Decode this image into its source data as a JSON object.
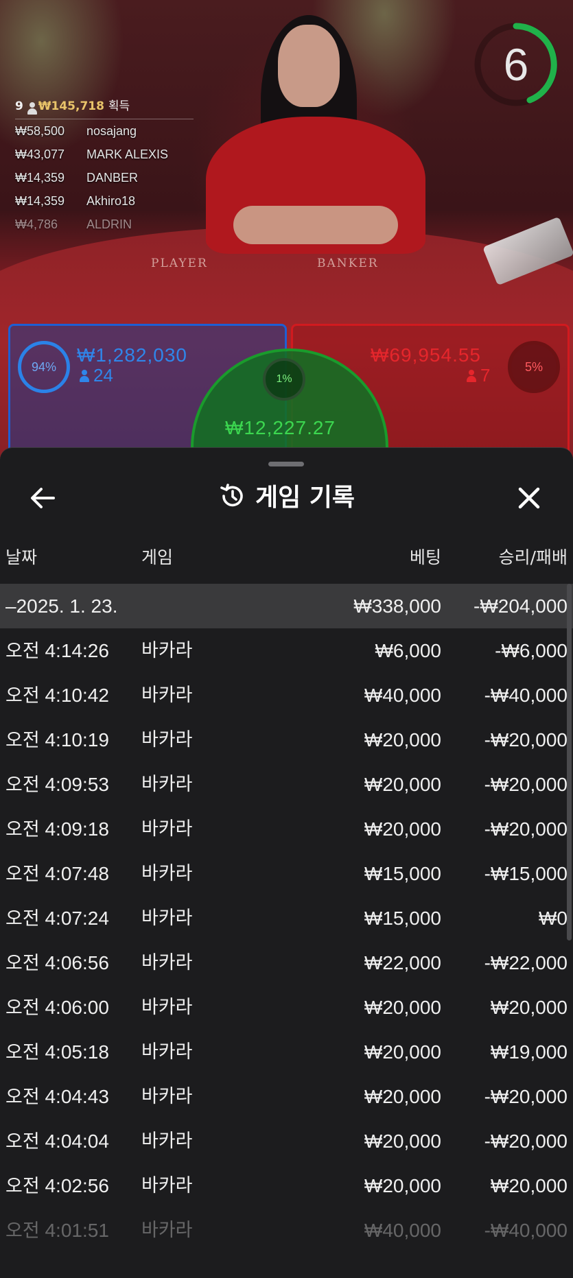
{
  "table": {
    "timer": "6",
    "player_label": "PLAYER",
    "banker_label": "BANKER",
    "winners": {
      "count": "9",
      "total": "₩145,718",
      "label": "획득",
      "rows": [
        {
          "amount": "₩58,500",
          "name": "nosajang"
        },
        {
          "amount": "₩43,077",
          "name": "MARK ALEXIS"
        },
        {
          "amount": "₩14,359",
          "name": "DANBER"
        },
        {
          "amount": "₩14,359",
          "name": "Akhiro18"
        },
        {
          "amount": "₩4,786",
          "name": "ALDRIN"
        }
      ]
    },
    "player": {
      "percent": "94%",
      "pot": "₩1,282,030",
      "players": "24",
      "color": "#2f86ea"
    },
    "banker": {
      "percent": "5%",
      "pot": "₩69,954.55",
      "players": "7",
      "color": "#e5262c"
    },
    "tie": {
      "percent": "1%",
      "pot": "₩12,227.27",
      "color": "#3cd750"
    }
  },
  "sheet": {
    "title": "게임 기록",
    "icons": {
      "back": "arrow-left-icon",
      "history": "history-icon",
      "close": "close-icon"
    },
    "columns": {
      "date": "날짜",
      "game": "게임",
      "bet": "베팅",
      "result": "승리/패배"
    },
    "day_row": {
      "date": "–2025. 1. 23.",
      "bet": "₩338,000",
      "result": "-₩204,000"
    },
    "rows": [
      {
        "ampm": "오전",
        "time": "4:14:26",
        "game": "바카라",
        "bet": "₩6,000",
        "result": "-₩6,000"
      },
      {
        "ampm": "오전",
        "time": "4:10:42",
        "game": "바카라",
        "bet": "₩40,000",
        "result": "-₩40,000"
      },
      {
        "ampm": "오전",
        "time": "4:10:19",
        "game": "바카라",
        "bet": "₩20,000",
        "result": "-₩20,000"
      },
      {
        "ampm": "오전",
        "time": "4:09:53",
        "game": "바카라",
        "bet": "₩20,000",
        "result": "-₩20,000"
      },
      {
        "ampm": "오전",
        "time": "4:09:18",
        "game": "바카라",
        "bet": "₩20,000",
        "result": "-₩20,000"
      },
      {
        "ampm": "오전",
        "time": "4:07:48",
        "game": "바카라",
        "bet": "₩15,000",
        "result": "-₩15,000"
      },
      {
        "ampm": "오전",
        "time": "4:07:24",
        "game": "바카라",
        "bet": "₩15,000",
        "result": "₩0"
      },
      {
        "ampm": "오전",
        "time": "4:06:56",
        "game": "바카라",
        "bet": "₩22,000",
        "result": "-₩22,000"
      },
      {
        "ampm": "오전",
        "time": "4:06:00",
        "game": "바카라",
        "bet": "₩20,000",
        "result": "₩20,000"
      },
      {
        "ampm": "오전",
        "time": "4:05:18",
        "game": "바카라",
        "bet": "₩20,000",
        "result": "₩19,000"
      },
      {
        "ampm": "오전",
        "time": "4:04:43",
        "game": "바카라",
        "bet": "₩20,000",
        "result": "-₩20,000"
      },
      {
        "ampm": "오전",
        "time": "4:04:04",
        "game": "바카라",
        "bet": "₩20,000",
        "result": "-₩20,000"
      },
      {
        "ampm": "오전",
        "time": "4:02:56",
        "game": "바카라",
        "bet": "₩20,000",
        "result": "₩20,000"
      },
      {
        "ampm": "오전",
        "time": "4:01:51",
        "game": "바카라",
        "bet": "₩40,000",
        "result": "-₩40,000"
      }
    ]
  }
}
